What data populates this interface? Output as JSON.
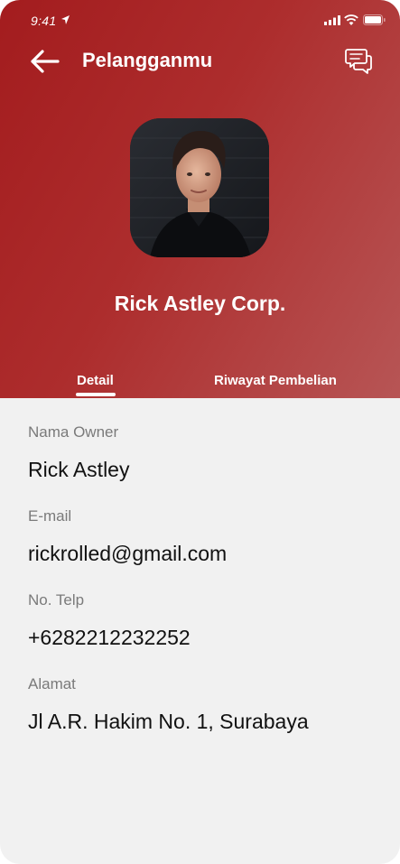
{
  "status_bar": {
    "time": "9:41"
  },
  "header": {
    "title": "Pelanggan",
    "title_suffix": "mu"
  },
  "profile": {
    "company_name": "Rick Astley Corp."
  },
  "tabs": [
    {
      "label": "Detail",
      "active": true
    },
    {
      "label": "Riwayat Pembelian",
      "active": false
    }
  ],
  "details": [
    {
      "label": "Nama Owner",
      "value": "Rick Astley"
    },
    {
      "label": "E-mail",
      "value": "rickrolled@gmail.com"
    },
    {
      "label": "No. Telp",
      "value": "+6282212232252"
    },
    {
      "label": "Alamat",
      "value": "Jl A.R. Hakim No. 1, Surabaya"
    }
  ],
  "colors": {
    "header_start": "#a31c1e",
    "header_end": "#b75555",
    "background": "#f1f1f1"
  },
  "icons": [
    "location-arrow-icon",
    "signal-icon",
    "wifi-icon",
    "battery-icon",
    "back-arrow-icon",
    "chat-icon"
  ]
}
